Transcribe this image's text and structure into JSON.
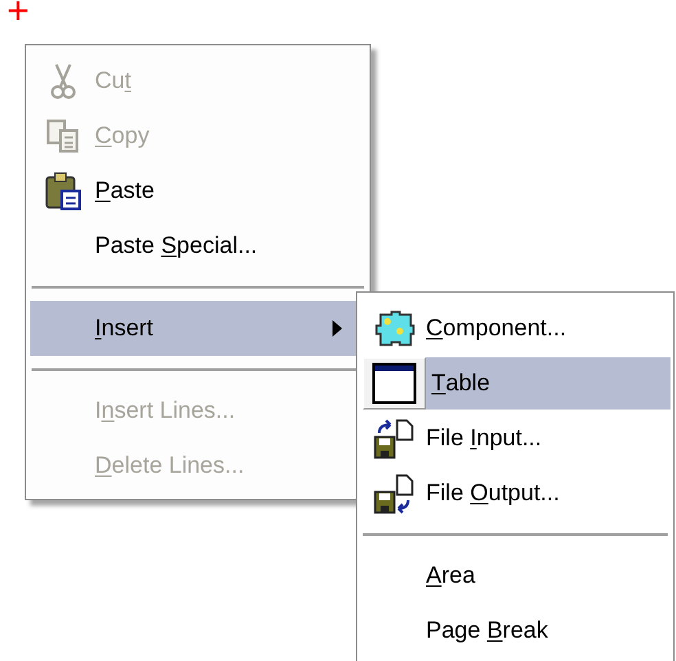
{
  "cursor": {
    "glyph": "+"
  },
  "context_menu": {
    "items": [
      {
        "kind": "item",
        "label": [
          {
            "text": "Cu"
          },
          {
            "text": "t",
            "underline": true
          }
        ],
        "disabled": true,
        "selected": false,
        "submenu": false
      },
      {
        "kind": "item",
        "label": [
          {
            "text": "C",
            "underline": true
          },
          {
            "text": "opy"
          }
        ],
        "disabled": true,
        "selected": false,
        "submenu": false
      },
      {
        "kind": "item",
        "label": [
          {
            "text": "P",
            "underline": true
          },
          {
            "text": "aste"
          }
        ],
        "disabled": false,
        "selected": false,
        "submenu": false
      },
      {
        "kind": "item",
        "label": [
          {
            "text": "Paste "
          },
          {
            "text": "S",
            "underline": true
          },
          {
            "text": "pecial..."
          }
        ],
        "disabled": false,
        "selected": false,
        "submenu": false
      },
      {
        "kind": "separator"
      },
      {
        "kind": "item",
        "label": [
          {
            "text": "I",
            "underline": true
          },
          {
            "text": "nsert"
          }
        ],
        "disabled": false,
        "selected": true,
        "submenu": true
      },
      {
        "kind": "separator"
      },
      {
        "kind": "item",
        "label": [
          {
            "text": "I"
          },
          {
            "text": "n",
            "underline": true
          },
          {
            "text": "sert Lines..."
          }
        ],
        "disabled": true,
        "selected": false,
        "submenu": false
      },
      {
        "kind": "item",
        "label": [
          {
            "text": "D",
            "underline": true
          },
          {
            "text": "elete Lines..."
          }
        ],
        "disabled": true,
        "selected": false,
        "submenu": false
      }
    ]
  },
  "submenu": {
    "items": [
      {
        "kind": "item",
        "label": [
          {
            "text": "C",
            "underline": true
          },
          {
            "text": "omponent..."
          }
        ],
        "disabled": false,
        "selected": false,
        "submenu": false
      },
      {
        "kind": "item",
        "label": [
          {
            "text": "T",
            "underline": true
          },
          {
            "text": "able"
          }
        ],
        "disabled": false,
        "selected": true,
        "submenu": false
      },
      {
        "kind": "item",
        "label": [
          {
            "text": "File "
          },
          {
            "text": "I",
            "underline": true
          },
          {
            "text": "nput..."
          }
        ],
        "disabled": false,
        "selected": false,
        "submenu": false
      },
      {
        "kind": "item",
        "label": [
          {
            "text": "File "
          },
          {
            "text": "O",
            "underline": true
          },
          {
            "text": "utput..."
          }
        ],
        "disabled": false,
        "selected": false,
        "submenu": false
      },
      {
        "kind": "separator"
      },
      {
        "kind": "item",
        "label": [
          {
            "text": "A",
            "underline": true
          },
          {
            "text": "rea"
          }
        ],
        "disabled": false,
        "selected": false,
        "submenu": false
      },
      {
        "kind": "item",
        "label": [
          {
            "text": "Page "
          },
          {
            "text": "B",
            "underline": true
          },
          {
            "text": "reak"
          }
        ],
        "disabled": false,
        "selected": false,
        "submenu": false
      }
    ]
  }
}
